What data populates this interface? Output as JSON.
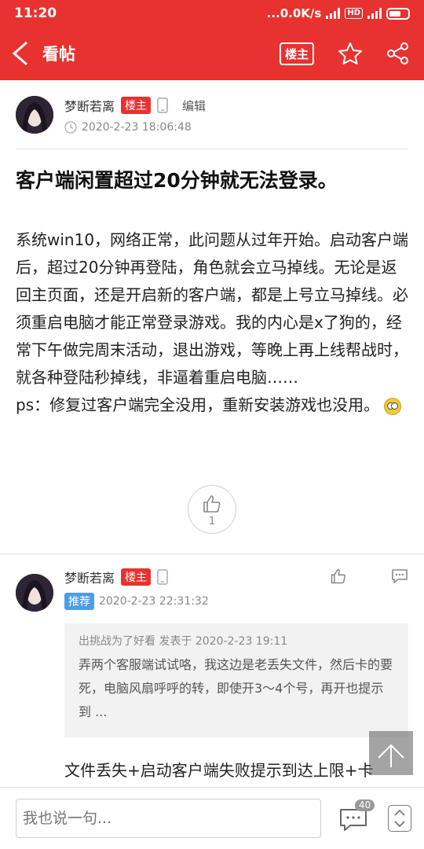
{
  "status_bar": {
    "time": "11:20",
    "network_speed": "...0.0K/s",
    "hd_label": "HD"
  },
  "nav": {
    "title": "看帖",
    "op_only_label": "楼主"
  },
  "post": {
    "author": "梦断若离",
    "author_badge": "楼主",
    "edit_label": "编辑",
    "time": "2020-2-23 18:06:48",
    "title": "客户端闲置超过20分钟就无法登录。",
    "content": "系统win10，网络正常，此问题从过年开始。启动客户端后，超过20分钟再登陆，角色就会立马掉线。无论是返回主页面，还是开启新的客户端，都是上号立马掉线。必须重启电脑才能正常登录游戏。我的内心是x了狗的，经常下午做完周末活动，退出游戏，等晚上再上线帮战时，就各种登陆秒掉线，非逼着重启电脑……",
    "ps": "ps：修复过客户端完全没用，重新安装游戏也没用。",
    "like_count": "1"
  },
  "reply": {
    "author": "梦断若离",
    "author_badge": "楼主",
    "recommend_badge": "推荐",
    "time": "2020-2-23 22:31:32",
    "quote_meta": "出挑战为了好看 发表于 2020-2-23 19:11",
    "quote_text": "弄两个客服端试试咯，我这边是老丢失文件，然后卡的要死，电脑风扇呼呼的转，即使开3～4个号，再开也提示到 ...",
    "text": "文件丢失+启动客户端失败提示到达上限+卡"
  },
  "bottom": {
    "input_placeholder": "我也说一句...",
    "comment_count": "40"
  },
  "colors": {
    "accent": "#e8322f",
    "badge_blue": "#4a9ee8"
  }
}
